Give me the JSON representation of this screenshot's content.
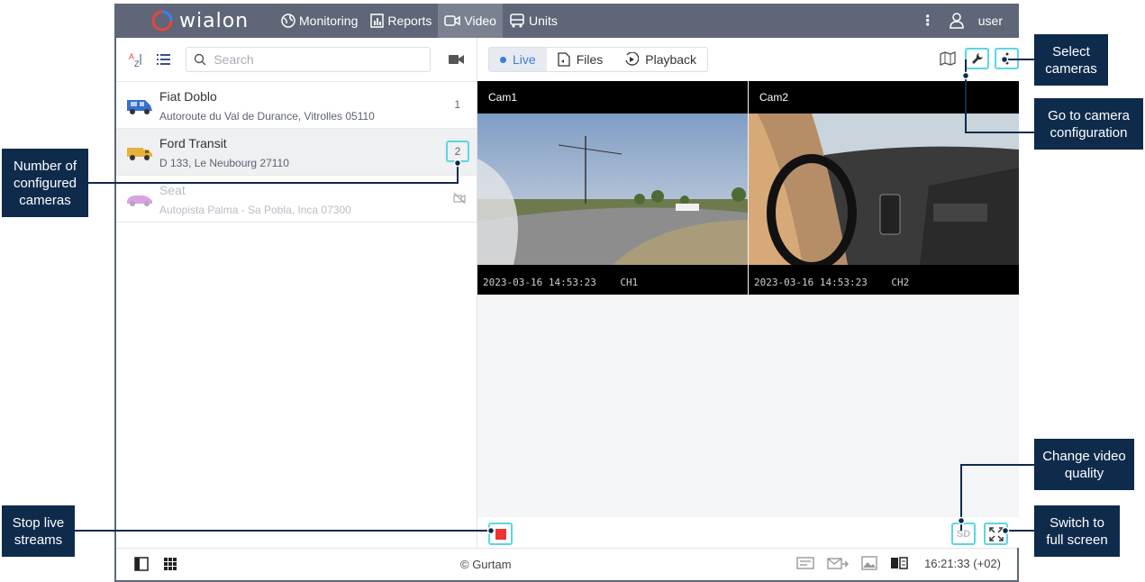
{
  "app": {
    "logo_text": "wialon",
    "nav": [
      {
        "label": "Monitoring",
        "icon": "globe-icon"
      },
      {
        "label": "Reports",
        "icon": "report-icon"
      },
      {
        "label": "Video",
        "icon": "video-camera-icon",
        "active": true
      },
      {
        "label": "Units",
        "icon": "bus-icon"
      }
    ],
    "user": "user"
  },
  "left_panel": {
    "search_placeholder": "Search",
    "units": [
      {
        "name": "Fiat Doblo",
        "address": "Autoroute du Val de Durance, Vitrolles 05110",
        "cameras": "1"
      },
      {
        "name": "Ford Transit",
        "address": "D 133, Le Neubourg 27110",
        "cameras": "2",
        "selected": true
      },
      {
        "name": "Seat",
        "address": "Autopista Palma - Sa Pobla, Inca 07300",
        "cameras": "",
        "disabled": true
      }
    ]
  },
  "right_panel": {
    "tabs": [
      {
        "label": "Live",
        "active": true
      },
      {
        "label": "Files"
      },
      {
        "label": "Playback"
      }
    ],
    "cameras": [
      {
        "label": "Cam1",
        "timestamp": "2023-03-16 14:53:23",
        "channel": "CH1"
      },
      {
        "label": "Cam2",
        "timestamp": "2023-03-16 14:53:23",
        "channel": "CH2"
      }
    ],
    "quality": "SD"
  },
  "footer": {
    "copyright": "© Gurtam",
    "clock": "16:21:33 (+02)"
  },
  "callouts": {
    "select_cameras": "Select cameras",
    "camera_config": "Go to camera configuration",
    "num_cameras": "Number of configured cameras",
    "video_quality": "Change video quality",
    "stop_streams": "Stop live streams",
    "full_screen": "Switch to full screen"
  },
  "colors": {
    "topbar": "#5f6677",
    "accent": "#3d7be0",
    "highlight": "#5bd6e3",
    "callout": "#0f2b4c",
    "stop": "#ee3333"
  }
}
